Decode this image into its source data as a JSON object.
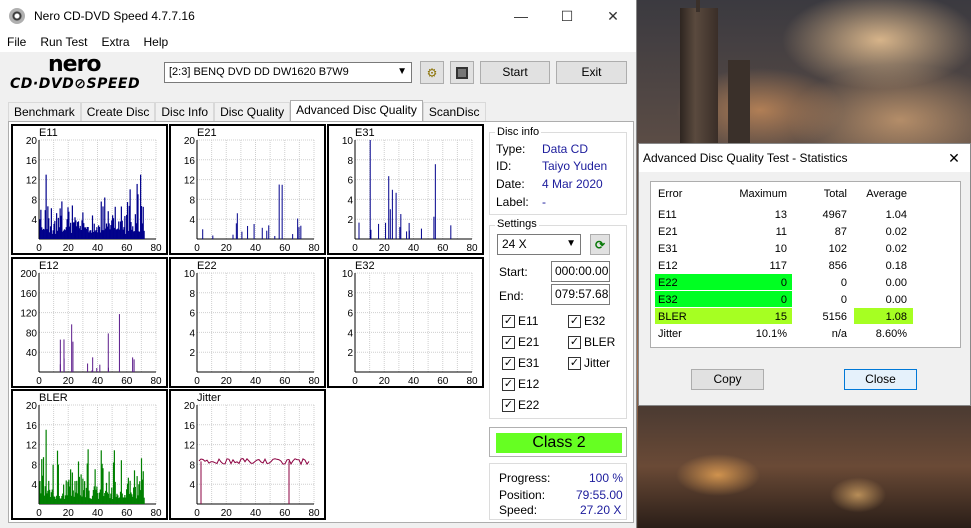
{
  "window": {
    "title": "Nero CD-DVD Speed 4.7.7.16",
    "minimize": "—",
    "maximize": "☐",
    "close": "✕"
  },
  "menu": [
    "File",
    "Run Test",
    "Extra",
    "Help"
  ],
  "logo": {
    "line1": "nero",
    "line2": "CD·DVD⊘SPEED"
  },
  "toolbar": {
    "drive": "[2:3]   BENQ DVD DD DW1620 B7W9",
    "start_label": "Start",
    "exit_label": "Exit"
  },
  "tabs": [
    "Benchmark",
    "Create Disc",
    "Disc Info",
    "Disc Quality",
    "Advanced Disc Quality",
    "ScanDisc"
  ],
  "active_tab": "Advanced Disc Quality",
  "disc_info": {
    "title": "Disc info",
    "type_label": "Type:",
    "type": "Data CD",
    "id_label": "ID:",
    "id": "Taiyo Yuden",
    "date_label": "Date:",
    "date": "4 Mar 2020",
    "label_label": "Label:",
    "label": "-"
  },
  "settings": {
    "title": "Settings",
    "speed": "24 X",
    "start_label": "Start:",
    "start": "000:00.00",
    "end_label": "End:",
    "end": "079:57.68",
    "checks": [
      {
        "label": "E11",
        "checked": true
      },
      {
        "label": "E32",
        "checked": true
      },
      {
        "label": "E21",
        "checked": true
      },
      {
        "label": "BLER",
        "checked": true
      },
      {
        "label": "E31",
        "checked": true
      },
      {
        "label": "Jitter",
        "checked": true
      },
      {
        "label": "E12",
        "checked": true
      },
      {
        "label": "E22",
        "checked": true
      }
    ]
  },
  "class_result": "Class 2",
  "progress": {
    "progress_label": "Progress:",
    "progress": "100 %",
    "position_label": "Position:",
    "position": "79:55.00",
    "speed_label": "Speed:",
    "speed": "27.20 X"
  },
  "chart_data": [
    {
      "name": "E11",
      "type": "bar",
      "x_ticks": [
        "0",
        "20",
        "40",
        "60",
        "80"
      ],
      "y_ticks": [
        "20",
        "16",
        "12",
        "8",
        "4"
      ],
      "ylim": [
        0,
        20
      ],
      "color": "#00008b",
      "profile": "dense",
      "max": 13
    },
    {
      "name": "E21",
      "type": "bar",
      "x_ticks": [
        "0",
        "20",
        "40",
        "60",
        "80"
      ],
      "y_ticks": [
        "20",
        "16",
        "12",
        "8",
        "4"
      ],
      "ylim": [
        0,
        20
      ],
      "color": "#00008b",
      "profile": "sparse",
      "max": 11
    },
    {
      "name": "E31",
      "type": "bar",
      "x_ticks": [
        "0",
        "20",
        "40",
        "60",
        "80"
      ],
      "y_ticks": [
        "10",
        "8",
        "6",
        "4",
        "2"
      ],
      "ylim": [
        0,
        10
      ],
      "color": "#00008b",
      "profile": "sparse",
      "max": 10
    },
    {
      "name": "E12",
      "type": "bar",
      "x_ticks": [
        "0",
        "20",
        "40",
        "60",
        "80"
      ],
      "y_ticks": [
        "200",
        "160",
        "120",
        "80",
        "40"
      ],
      "ylim": [
        0,
        200
      ],
      "color": "#5a1a8a",
      "profile": "sparse",
      "max": 117
    },
    {
      "name": "E22",
      "type": "bar",
      "x_ticks": [
        "0",
        "20",
        "40",
        "60",
        "80"
      ],
      "y_ticks": [
        "10",
        "8",
        "6",
        "4",
        "2"
      ],
      "ylim": [
        0,
        10
      ],
      "color": "#5a1a8a",
      "profile": "empty",
      "max": 0
    },
    {
      "name": "E32",
      "type": "bar",
      "x_ticks": [
        "0",
        "20",
        "40",
        "60",
        "80"
      ],
      "y_ticks": [
        "10",
        "8",
        "6",
        "4",
        "2"
      ],
      "ylim": [
        0,
        10
      ],
      "color": "#5a1a8a",
      "profile": "empty",
      "max": 0
    },
    {
      "name": "BLER",
      "type": "bar",
      "x_ticks": [
        "0",
        "20",
        "40",
        "60",
        "80"
      ],
      "y_ticks": [
        "20",
        "16",
        "12",
        "8",
        "4"
      ],
      "ylim": [
        0,
        20
      ],
      "color": "#008000",
      "profile": "dense",
      "max": 15
    },
    {
      "name": "Jitter",
      "type": "line",
      "x_ticks": [
        "0",
        "20",
        "40",
        "60",
        "80"
      ],
      "y_ticks": [
        "20",
        "16",
        "12",
        "8",
        "4"
      ],
      "ylim": [
        0,
        20
      ],
      "color": "#8b0040",
      "level": 8.6
    }
  ],
  "stats": {
    "title": "Advanced Disc Quality Test - Statistics",
    "close": "✕",
    "headers": [
      "Error",
      "Maximum",
      "Total",
      "Average"
    ],
    "rows": [
      [
        "E11",
        "13",
        "4967",
        "1.04"
      ],
      [
        "E21",
        "11",
        "87",
        "0.02"
      ],
      [
        "E31",
        "10",
        "102",
        "0.02"
      ],
      [
        "E12",
        "117",
        "856",
        "0.18"
      ],
      [
        "E22",
        "0",
        "0",
        "0.00"
      ],
      [
        "E32",
        "0",
        "0",
        "0.00"
      ],
      [
        "BLER",
        "15",
        "5156",
        "1.08"
      ],
      [
        "Jitter",
        "10.1%",
        "n/a",
        "8.60%"
      ]
    ],
    "highlight_green": "#00ff22",
    "highlight_lime": "#a6ff22",
    "copy_label": "Copy",
    "close_label": "Close"
  }
}
